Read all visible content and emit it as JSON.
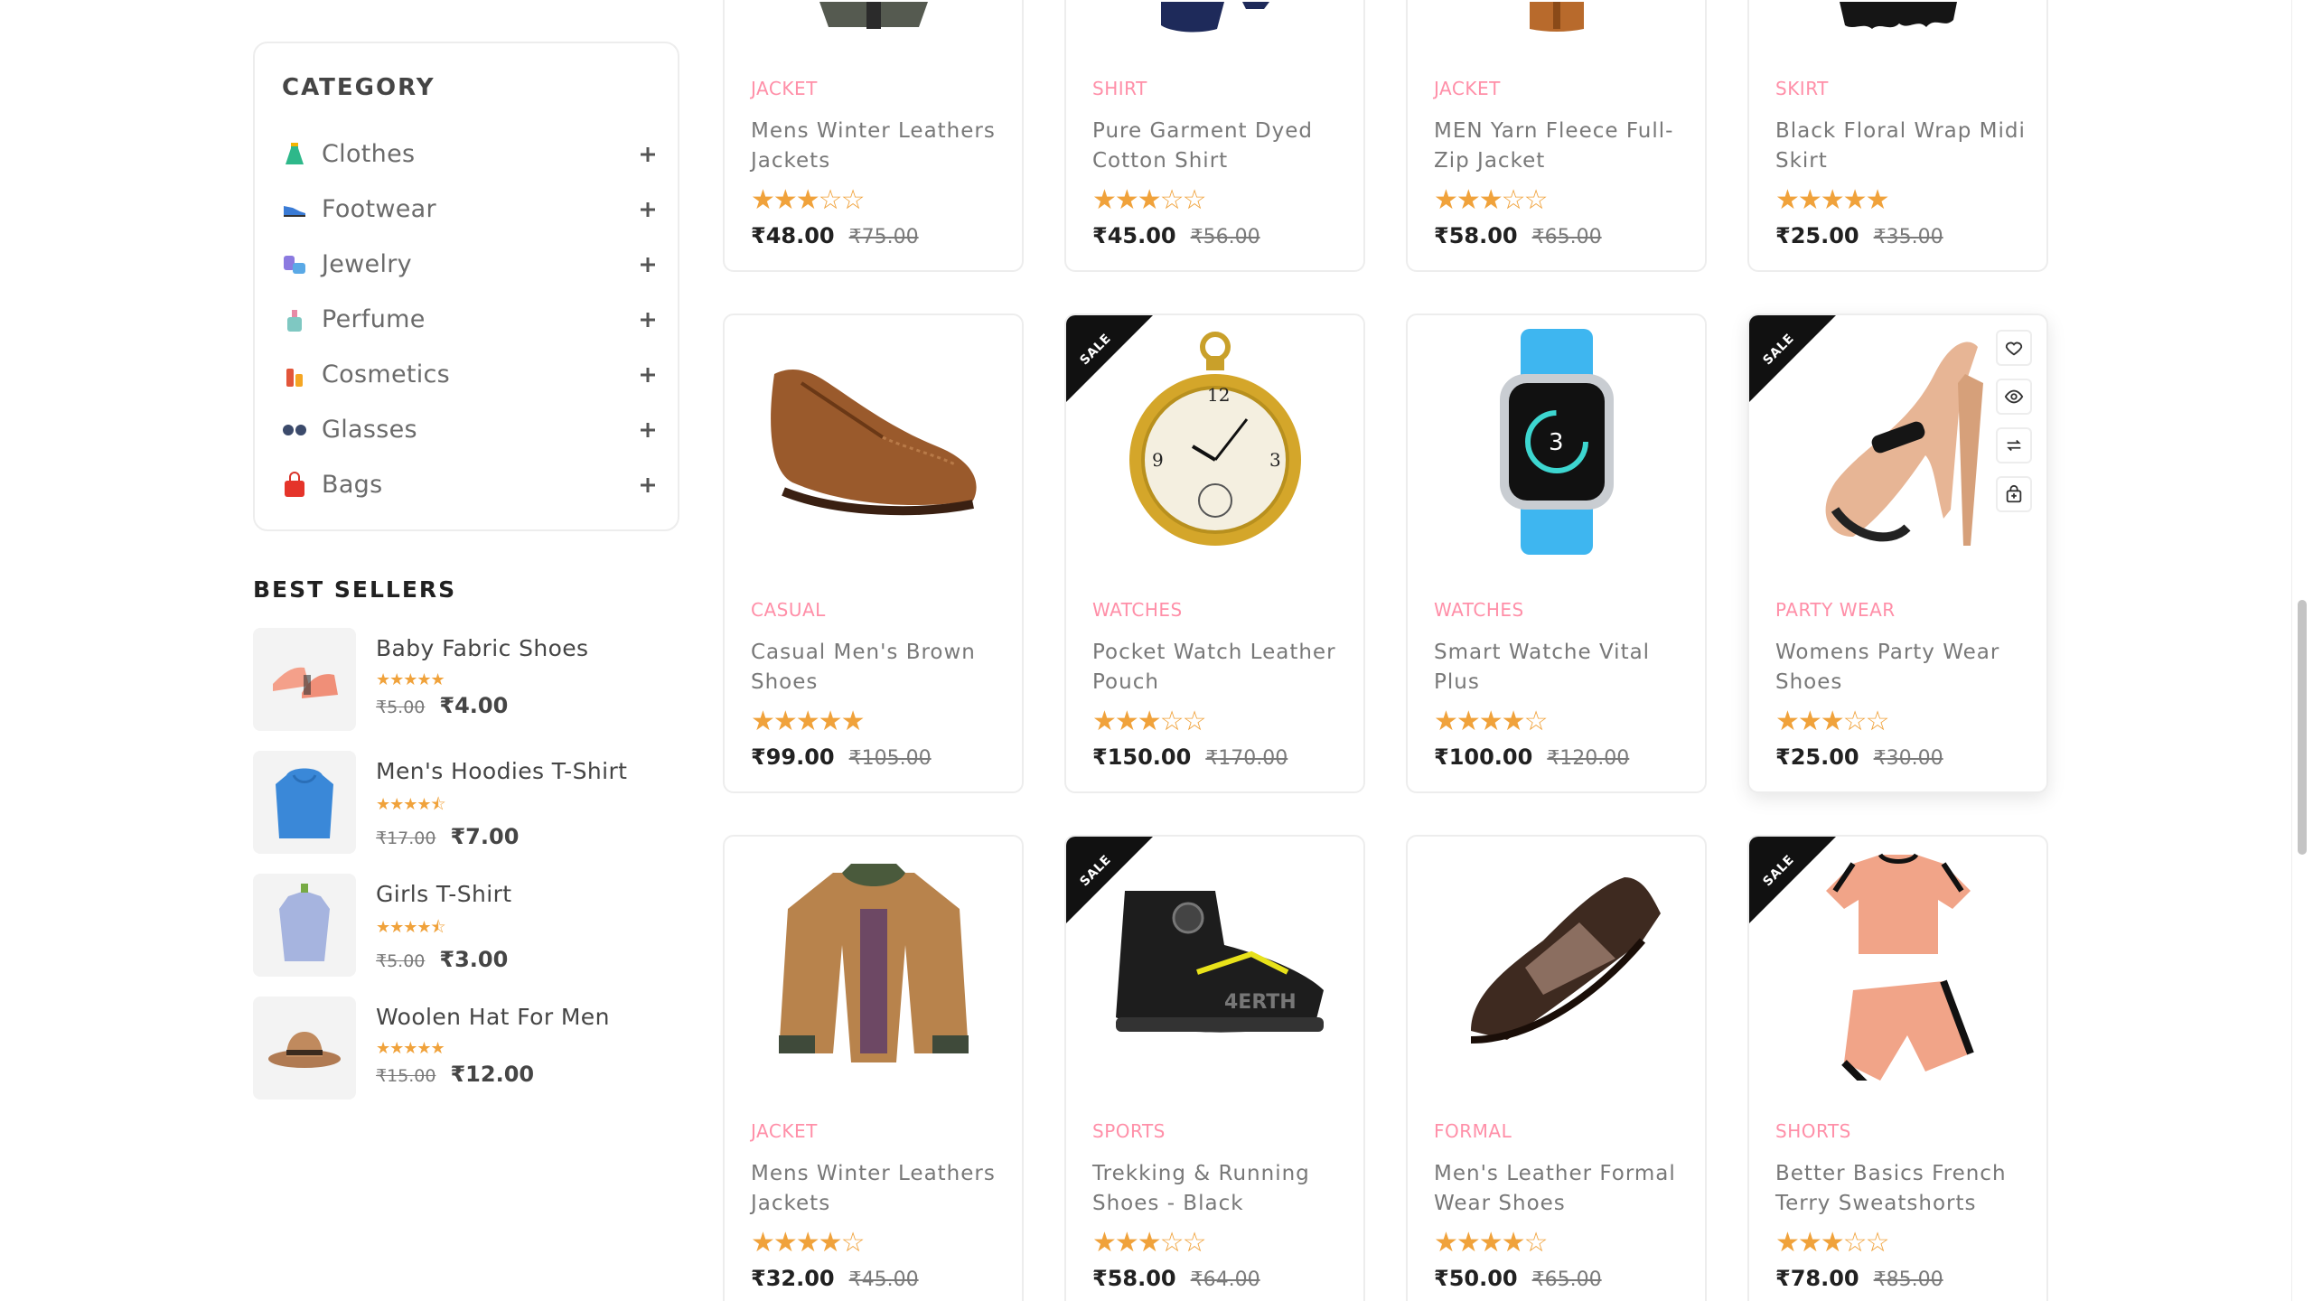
{
  "sidebar": {
    "category_title": "CATEGORY",
    "categories": [
      {
        "label": "Clothes",
        "icon": "dress-icon"
      },
      {
        "label": "Footwear",
        "icon": "shoe-icon"
      },
      {
        "label": "Jewelry",
        "icon": "jewelry-icon"
      },
      {
        "label": "Perfume",
        "icon": "perfume-icon"
      },
      {
        "label": "Cosmetics",
        "icon": "cosmetics-icon"
      },
      {
        "label": "Glasses",
        "icon": "glasses-icon"
      },
      {
        "label": "Bags",
        "icon": "bag-icon"
      }
    ],
    "best_sellers_title": "BEST SELLERS",
    "best_sellers": [
      {
        "name": "Baby Fabric Shoes",
        "stars": "★★★★★",
        "rating": 5,
        "old_price": "₹5.00",
        "price": "₹4.00"
      },
      {
        "name": "Men's Hoodies T-Shirt",
        "stars": "★★★★⯪",
        "rating": 4.5,
        "old_price": "₹17.00",
        "price": "₹7.00"
      },
      {
        "name": "Girls T-Shirt",
        "stars": "★★★★⯪",
        "rating": 4.5,
        "old_price": "₹5.00",
        "price": "₹3.00"
      },
      {
        "name": "Woolen Hat For Men",
        "stars": "★★★★★",
        "rating": 5,
        "old_price": "₹15.00",
        "price": "₹12.00"
      }
    ]
  },
  "products": [
    {
      "category": "JACKET",
      "name": "Mens Winter Leathers Jackets",
      "stars": "★★★☆☆",
      "rating": 3,
      "price": "₹48.00",
      "old_price": "₹75.00",
      "sale": false
    },
    {
      "category": "SHIRT",
      "name": "Pure Garment Dyed Cotton Shirt",
      "stars": "★★★☆☆",
      "rating": 3,
      "price": "₹45.00",
      "old_price": "₹56.00",
      "sale": false
    },
    {
      "category": "JACKET",
      "name": "MEN Yarn Fleece Full-Zip Jacket",
      "stars": "★★★☆☆",
      "rating": 3,
      "price": "₹58.00",
      "old_price": "₹65.00",
      "sale": false
    },
    {
      "category": "SKIRT",
      "name": "Black Floral Wrap Midi Skirt",
      "stars": "★★★★★",
      "rating": 5,
      "price": "₹25.00",
      "old_price": "₹35.00",
      "sale": false
    },
    {
      "category": "CASUAL",
      "name": "Casual Men's Brown Shoes",
      "stars": "★★★★★",
      "rating": 5,
      "price": "₹99.00",
      "old_price": "₹105.00",
      "sale": false
    },
    {
      "category": "WATCHES",
      "name": "Pocket Watch Leather Pouch",
      "stars": "★★★☆☆",
      "rating": 3,
      "price": "₹150.00",
      "old_price": "₹170.00",
      "sale": true
    },
    {
      "category": "WATCHES",
      "name": "Smart Watche Vital Plus",
      "stars": "★★★★☆",
      "rating": 4,
      "price": "₹100.00",
      "old_price": "₹120.00",
      "sale": false
    },
    {
      "category": "PARTY WEAR",
      "name": "Womens Party Wear Shoes",
      "stars": "★★★☆☆",
      "rating": 3,
      "price": "₹25.00",
      "old_price": "₹30.00",
      "sale": true
    },
    {
      "category": "JACKET",
      "name": "Mens Winter Leathers Jackets",
      "stars": "★★★★☆",
      "rating": 4,
      "price": "₹32.00",
      "old_price": "₹45.00",
      "sale": false
    },
    {
      "category": "SPORTS",
      "name": "Trekking & Running Shoes - Black",
      "stars": "★★★☆☆",
      "rating": 3,
      "price": "₹58.00",
      "old_price": "₹64.00",
      "sale": true
    },
    {
      "category": "FORMAL",
      "name": "Men's Leather Formal Wear Shoes",
      "stars": "★★★★☆",
      "rating": 4,
      "price": "₹50.00",
      "old_price": "₹65.00",
      "sale": false
    },
    {
      "category": "SHORTS",
      "name": "Better Basics French Terry Sweatshorts",
      "stars": "★★★☆☆",
      "rating": 3,
      "price": "₹78.00",
      "old_price": "₹85.00",
      "sale": true
    }
  ],
  "sale_badge": "SALE",
  "colors": {
    "accent_pink": "#ff8fa8",
    "star": "#f0a23b",
    "text_dark": "#212121"
  }
}
